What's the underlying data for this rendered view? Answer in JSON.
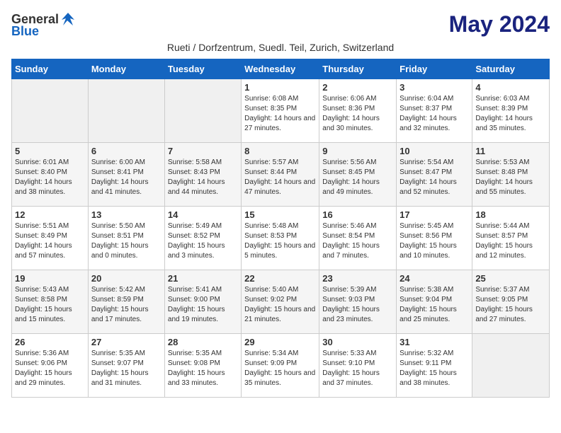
{
  "header": {
    "logo_general": "General",
    "logo_blue": "Blue",
    "month_title": "May 2024",
    "subtitle": "Rueti / Dorfzentrum, Suedl. Teil, Zurich, Switzerland"
  },
  "days_of_week": [
    "Sunday",
    "Monday",
    "Tuesday",
    "Wednesday",
    "Thursday",
    "Friday",
    "Saturday"
  ],
  "weeks": [
    [
      {
        "day": "",
        "empty": true
      },
      {
        "day": "",
        "empty": true
      },
      {
        "day": "",
        "empty": true
      },
      {
        "day": "1",
        "sunrise": "6:08 AM",
        "sunset": "8:35 PM",
        "daylight": "14 hours and 27 minutes."
      },
      {
        "day": "2",
        "sunrise": "6:06 AM",
        "sunset": "8:36 PM",
        "daylight": "14 hours and 30 minutes."
      },
      {
        "day": "3",
        "sunrise": "6:04 AM",
        "sunset": "8:37 PM",
        "daylight": "14 hours and 32 minutes."
      },
      {
        "day": "4",
        "sunrise": "6:03 AM",
        "sunset": "8:39 PM",
        "daylight": "14 hours and 35 minutes."
      }
    ],
    [
      {
        "day": "5",
        "sunrise": "6:01 AM",
        "sunset": "8:40 PM",
        "daylight": "14 hours and 38 minutes."
      },
      {
        "day": "6",
        "sunrise": "6:00 AM",
        "sunset": "8:41 PM",
        "daylight": "14 hours and 41 minutes."
      },
      {
        "day": "7",
        "sunrise": "5:58 AM",
        "sunset": "8:43 PM",
        "daylight": "14 hours and 44 minutes."
      },
      {
        "day": "8",
        "sunrise": "5:57 AM",
        "sunset": "8:44 PM",
        "daylight": "14 hours and 47 minutes."
      },
      {
        "day": "9",
        "sunrise": "5:56 AM",
        "sunset": "8:45 PM",
        "daylight": "14 hours and 49 minutes."
      },
      {
        "day": "10",
        "sunrise": "5:54 AM",
        "sunset": "8:47 PM",
        "daylight": "14 hours and 52 minutes."
      },
      {
        "day": "11",
        "sunrise": "5:53 AM",
        "sunset": "8:48 PM",
        "daylight": "14 hours and 55 minutes."
      }
    ],
    [
      {
        "day": "12",
        "sunrise": "5:51 AM",
        "sunset": "8:49 PM",
        "daylight": "14 hours and 57 minutes."
      },
      {
        "day": "13",
        "sunrise": "5:50 AM",
        "sunset": "8:51 PM",
        "daylight": "15 hours and 0 minutes."
      },
      {
        "day": "14",
        "sunrise": "5:49 AM",
        "sunset": "8:52 PM",
        "daylight": "15 hours and 3 minutes."
      },
      {
        "day": "15",
        "sunrise": "5:48 AM",
        "sunset": "8:53 PM",
        "daylight": "15 hours and 5 minutes."
      },
      {
        "day": "16",
        "sunrise": "5:46 AM",
        "sunset": "8:54 PM",
        "daylight": "15 hours and 7 minutes."
      },
      {
        "day": "17",
        "sunrise": "5:45 AM",
        "sunset": "8:56 PM",
        "daylight": "15 hours and 10 minutes."
      },
      {
        "day": "18",
        "sunrise": "5:44 AM",
        "sunset": "8:57 PM",
        "daylight": "15 hours and 12 minutes."
      }
    ],
    [
      {
        "day": "19",
        "sunrise": "5:43 AM",
        "sunset": "8:58 PM",
        "daylight": "15 hours and 15 minutes."
      },
      {
        "day": "20",
        "sunrise": "5:42 AM",
        "sunset": "8:59 PM",
        "daylight": "15 hours and 17 minutes."
      },
      {
        "day": "21",
        "sunrise": "5:41 AM",
        "sunset": "9:00 PM",
        "daylight": "15 hours and 19 minutes."
      },
      {
        "day": "22",
        "sunrise": "5:40 AM",
        "sunset": "9:02 PM",
        "daylight": "15 hours and 21 minutes."
      },
      {
        "day": "23",
        "sunrise": "5:39 AM",
        "sunset": "9:03 PM",
        "daylight": "15 hours and 23 minutes."
      },
      {
        "day": "24",
        "sunrise": "5:38 AM",
        "sunset": "9:04 PM",
        "daylight": "15 hours and 25 minutes."
      },
      {
        "day": "25",
        "sunrise": "5:37 AM",
        "sunset": "9:05 PM",
        "daylight": "15 hours and 27 minutes."
      }
    ],
    [
      {
        "day": "26",
        "sunrise": "5:36 AM",
        "sunset": "9:06 PM",
        "daylight": "15 hours and 29 minutes."
      },
      {
        "day": "27",
        "sunrise": "5:35 AM",
        "sunset": "9:07 PM",
        "daylight": "15 hours and 31 minutes."
      },
      {
        "day": "28",
        "sunrise": "5:35 AM",
        "sunset": "9:08 PM",
        "daylight": "15 hours and 33 minutes."
      },
      {
        "day": "29",
        "sunrise": "5:34 AM",
        "sunset": "9:09 PM",
        "daylight": "15 hours and 35 minutes."
      },
      {
        "day": "30",
        "sunrise": "5:33 AM",
        "sunset": "9:10 PM",
        "daylight": "15 hours and 37 minutes."
      },
      {
        "day": "31",
        "sunrise": "5:32 AM",
        "sunset": "9:11 PM",
        "daylight": "15 hours and 38 minutes."
      },
      {
        "day": "",
        "empty": true
      }
    ]
  ]
}
